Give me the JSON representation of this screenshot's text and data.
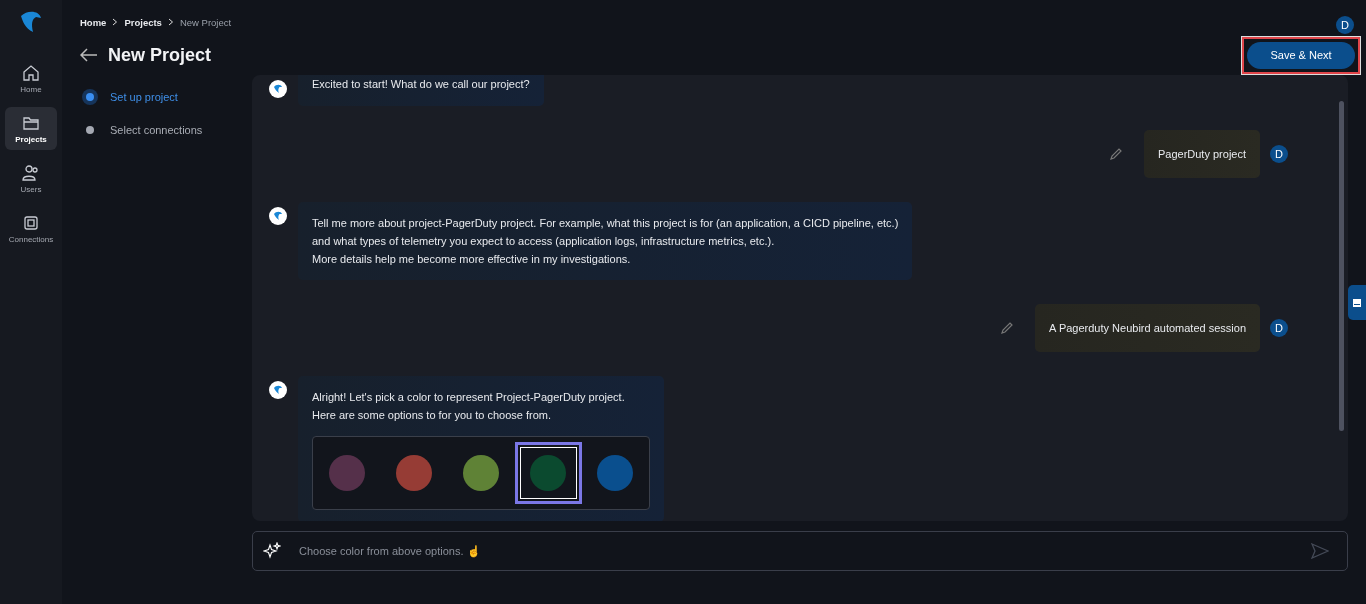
{
  "nav": [
    {
      "label": "Home",
      "kind": "home",
      "selected": false
    },
    {
      "label": "Projects",
      "kind": "folder",
      "selected": true
    },
    {
      "label": "Users",
      "kind": "users",
      "selected": false
    },
    {
      "label": "Connections",
      "kind": "chip",
      "selected": false
    }
  ],
  "breadcrumb": [
    "Home",
    "Projects",
    "New Project"
  ],
  "title": "New Project",
  "user_initial": "D",
  "save_button": {
    "label": "Save & Next",
    "highlighted": true
  },
  "steps": [
    {
      "label": "Set up project",
      "selected": true
    },
    {
      "label": "Select connections",
      "selected": false
    }
  ],
  "messages": [
    {
      "kind": "bot",
      "lines": [
        "Excited to start! What do we call our project?"
      ]
    },
    {
      "kind": "user",
      "lines": [
        "PagerDuty project"
      ],
      "avatar": "D"
    },
    {
      "kind": "bot",
      "lines": [
        "Tell me more about project-PagerDuty project. For example, what this project is for (an application, a CICD pipeline, etc.)",
        "and what types of telemetry you expect to access (application logs, infrastructure metrics, etc.).",
        "More details help me become more effective in my investigations."
      ]
    },
    {
      "kind": "user",
      "lines": [
        "A Pagerduty Neubird automated session"
      ],
      "avatar": "D"
    },
    {
      "kind": "bot",
      "lines": [
        "Alright! Let's pick a color to represent Project-PagerDuty project.",
        "Here are some options to for you to choose from."
      ],
      "color_options": [
        {
          "color": "#55304a",
          "selected": false
        },
        {
          "color": "#963c35",
          "selected": false
        },
        {
          "color": "#5f8236",
          "selected": false
        },
        {
          "color": "#0b4a2f",
          "selected": true
        },
        {
          "color": "#0a4f8e",
          "selected": false
        }
      ]
    }
  ],
  "input": {
    "placeholder": "Choose color from above options. ☝"
  }
}
